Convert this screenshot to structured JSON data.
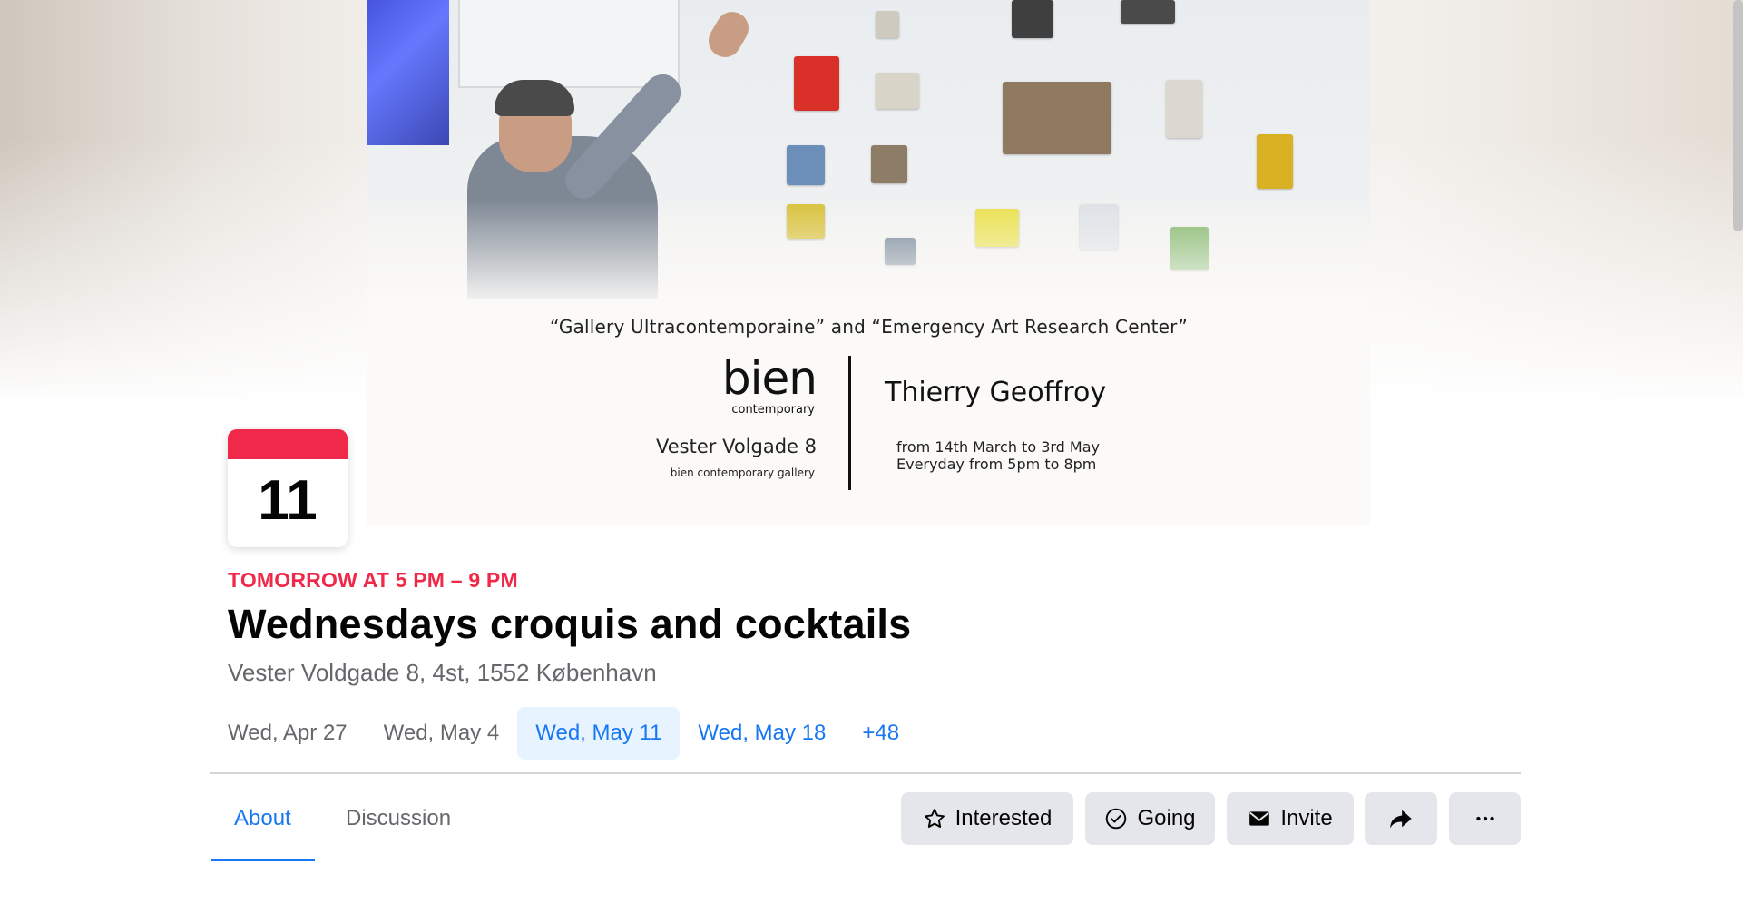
{
  "cover": {
    "quote": "“Gallery Ultracontemporaine”  and  “Emergency Art Research Center”",
    "logo_word": "bien",
    "logo_sub": "contemporary",
    "gallery_address": "Vester Volgade 8",
    "gallery_name": "bien contemporary gallery",
    "artist": "Thierry Geoffroy",
    "dates_line1": "from 14th March to 3rd May",
    "dates_line2": "Everyday from 5pm to 8pm"
  },
  "event": {
    "day": "11",
    "time": "TOMORROW AT 5 PM – 9 PM",
    "title": "Wednesdays croquis and cocktails",
    "location": "Vester Voldgade 8, 4st, 1552 København"
  },
  "dates": [
    "Wed, Apr 27",
    "Wed, May 4",
    "Wed, May 11",
    "Wed, May 18",
    "+48"
  ],
  "tabs": {
    "about": "About",
    "discussion": "Discussion"
  },
  "actions": {
    "interested": "Interested",
    "going": "Going",
    "invite": "Invite",
    "icons": [
      "star-icon",
      "check-circle-icon",
      "envelope-icon",
      "share-arrow-icon",
      "more-dots-icon"
    ]
  },
  "colors": {
    "accent": "#1877f2",
    "date_red": "#f02849",
    "button_bg": "#e4e6eb",
    "active_pill_bg": "#e7f3ff"
  }
}
